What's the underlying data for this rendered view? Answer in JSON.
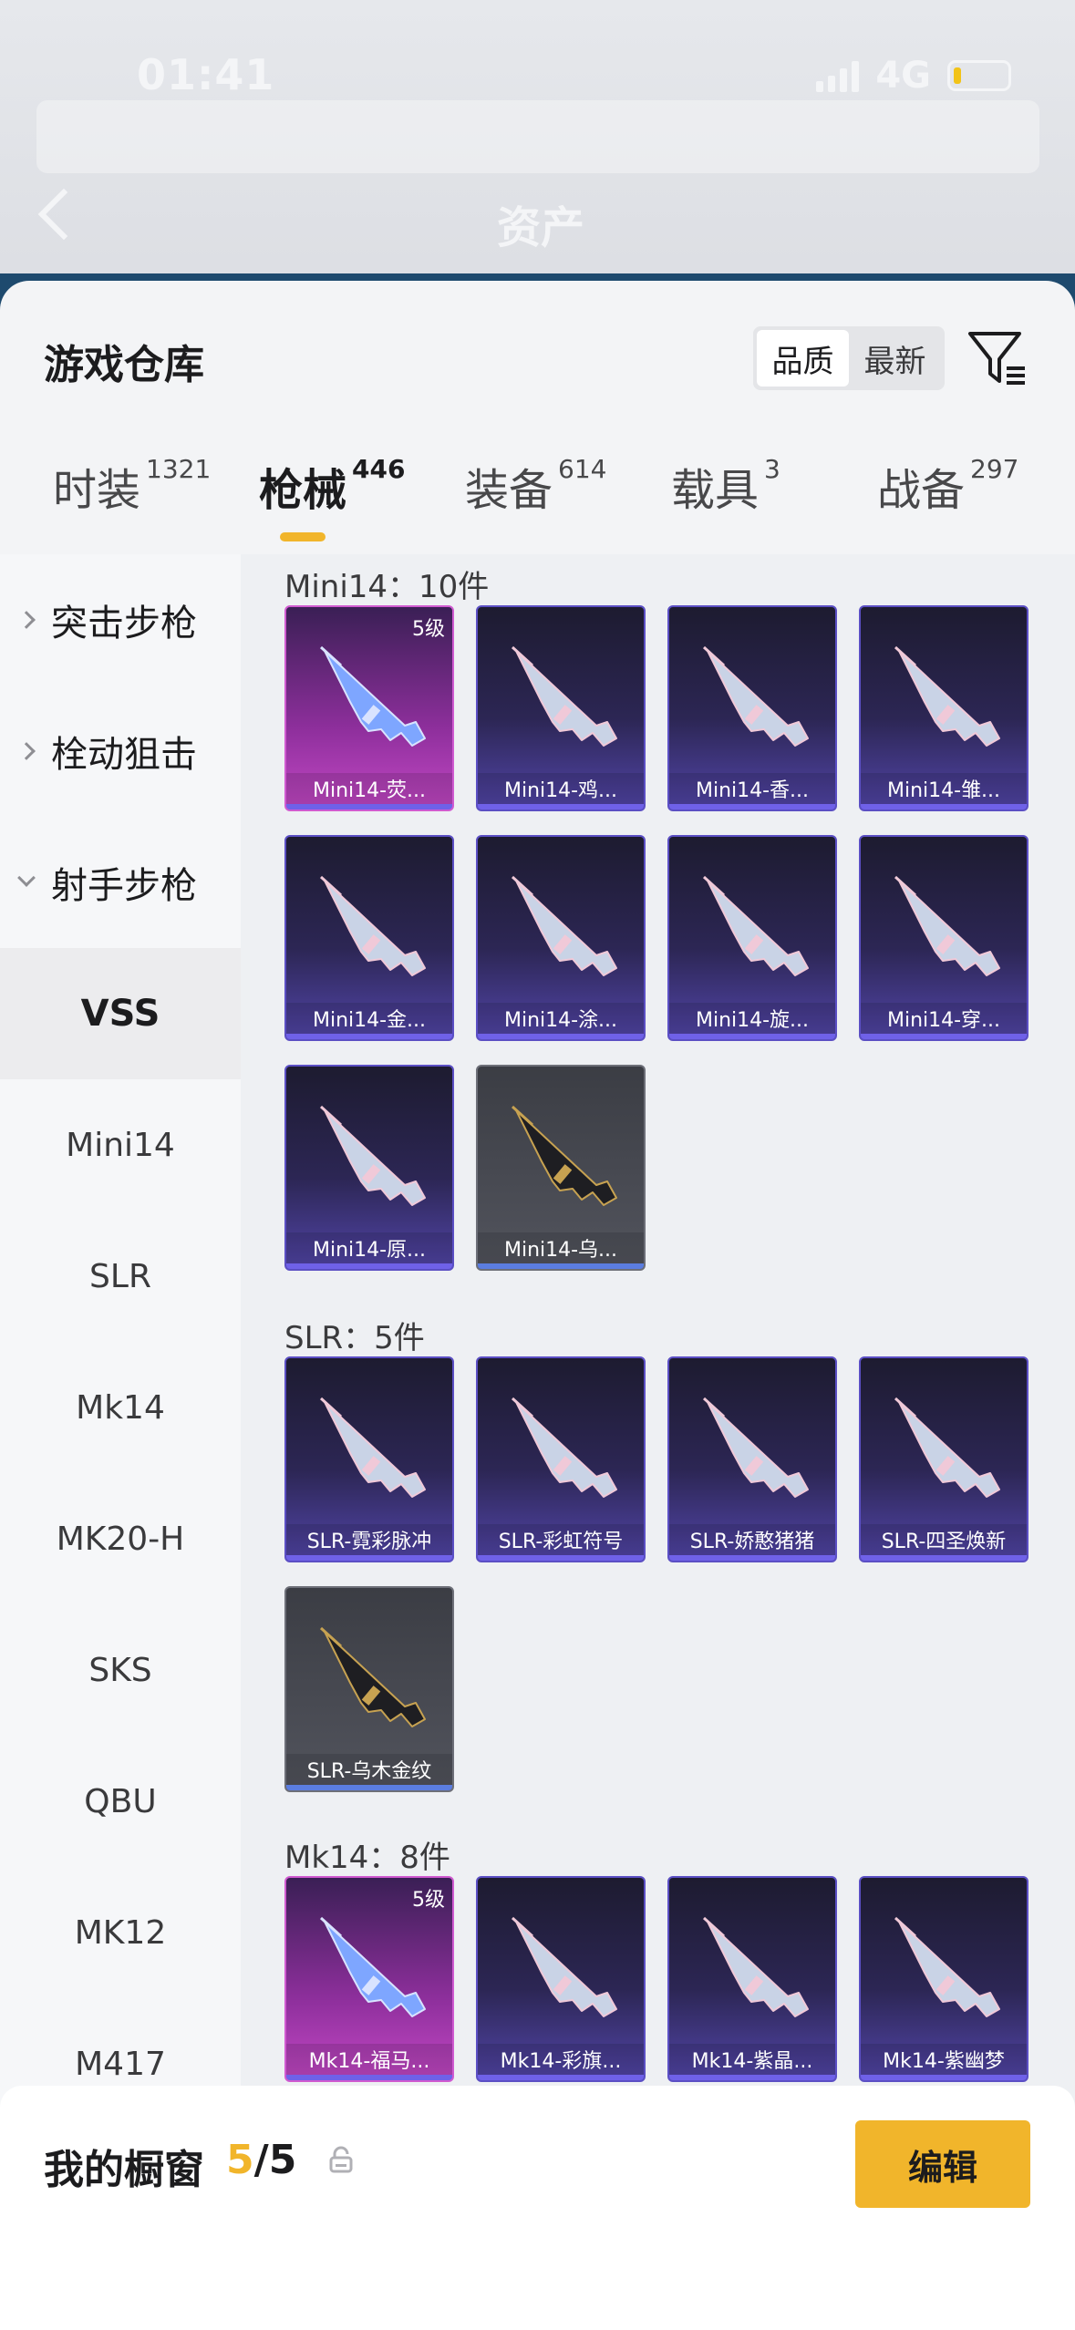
{
  "status_bar": {
    "time": "01:41",
    "network": "4G"
  },
  "header": {
    "title": "资产"
  },
  "sheet": {
    "title": "游戏仓库",
    "sort_options": [
      "品质",
      "最新"
    ],
    "sort_selected": "品质"
  },
  "tabs": [
    {
      "label": "时装",
      "count": "1321"
    },
    {
      "label": "枪械",
      "count": "446"
    },
    {
      "label": "装备",
      "count": "614"
    },
    {
      "label": "载具",
      "count": "3"
    },
    {
      "label": "战备",
      "count": "297"
    }
  ],
  "active_tab": "枪械",
  "sidebar": {
    "categories": [
      {
        "label": "突击步枪",
        "expanded": false
      },
      {
        "label": "栓动狙击",
        "expanded": false
      },
      {
        "label": "射手步枪",
        "expanded": true
      }
    ],
    "items": [
      "VSS",
      "Mini14",
      "SLR",
      "Mk14",
      "MK20-H",
      "SKS",
      "QBU",
      "MK12",
      "M417"
    ],
    "selected": "VSS"
  },
  "sections": [
    {
      "title": "Mini14：10件",
      "cards": [
        {
          "name": "Mini14-荧...",
          "level": "5级",
          "rarity": "gold"
        },
        {
          "name": "Mini14-鸡...",
          "rarity": "purple"
        },
        {
          "name": "Mini14-香...",
          "rarity": "purple"
        },
        {
          "name": "Mini14-雏...",
          "rarity": "purple"
        },
        {
          "name": "Mini14-金...",
          "rarity": "purple"
        },
        {
          "name": "Mini14-涂...",
          "rarity": "purple"
        },
        {
          "name": "Mini14-旋...",
          "rarity": "purple"
        },
        {
          "name": "Mini14-穿...",
          "rarity": "purple"
        },
        {
          "name": "Mini14-原...",
          "rarity": "purple"
        },
        {
          "name": "Mini14-乌...",
          "rarity": "grey"
        }
      ]
    },
    {
      "title": "SLR：5件",
      "cards": [
        {
          "name": "SLR-霓彩脉冲",
          "rarity": "purple"
        },
        {
          "name": "SLR-彩虹符号",
          "rarity": "purple"
        },
        {
          "name": "SLR-娇憨猪猪",
          "rarity": "purple"
        },
        {
          "name": "SLR-四圣焕新",
          "rarity": "purple"
        },
        {
          "name": "SLR-乌木金纹",
          "rarity": "grey"
        }
      ]
    },
    {
      "title": "Mk14：8件",
      "cards": [
        {
          "name": "Mk14-福马...",
          "level": "5级",
          "rarity": "gold"
        },
        {
          "name": "Mk14-彩旗...",
          "rarity": "purple"
        },
        {
          "name": "Mk14-紫晶...",
          "rarity": "purple"
        },
        {
          "name": "Mk14-紫幽梦",
          "rarity": "purple"
        }
      ]
    }
  ],
  "showcase": {
    "label": "我的橱窗",
    "current": "5",
    "total": "/5",
    "edit_label": "编辑"
  },
  "colors": {
    "accent": "#f1b52b",
    "card_purple": "#5245a8",
    "card_gold": "#c248c4",
    "card_grey": "#52545d"
  },
  "icons": {
    "back": "chevron-left-icon",
    "filter": "filter-icon",
    "lock": "lock-icon",
    "share": "share-icon"
  }
}
